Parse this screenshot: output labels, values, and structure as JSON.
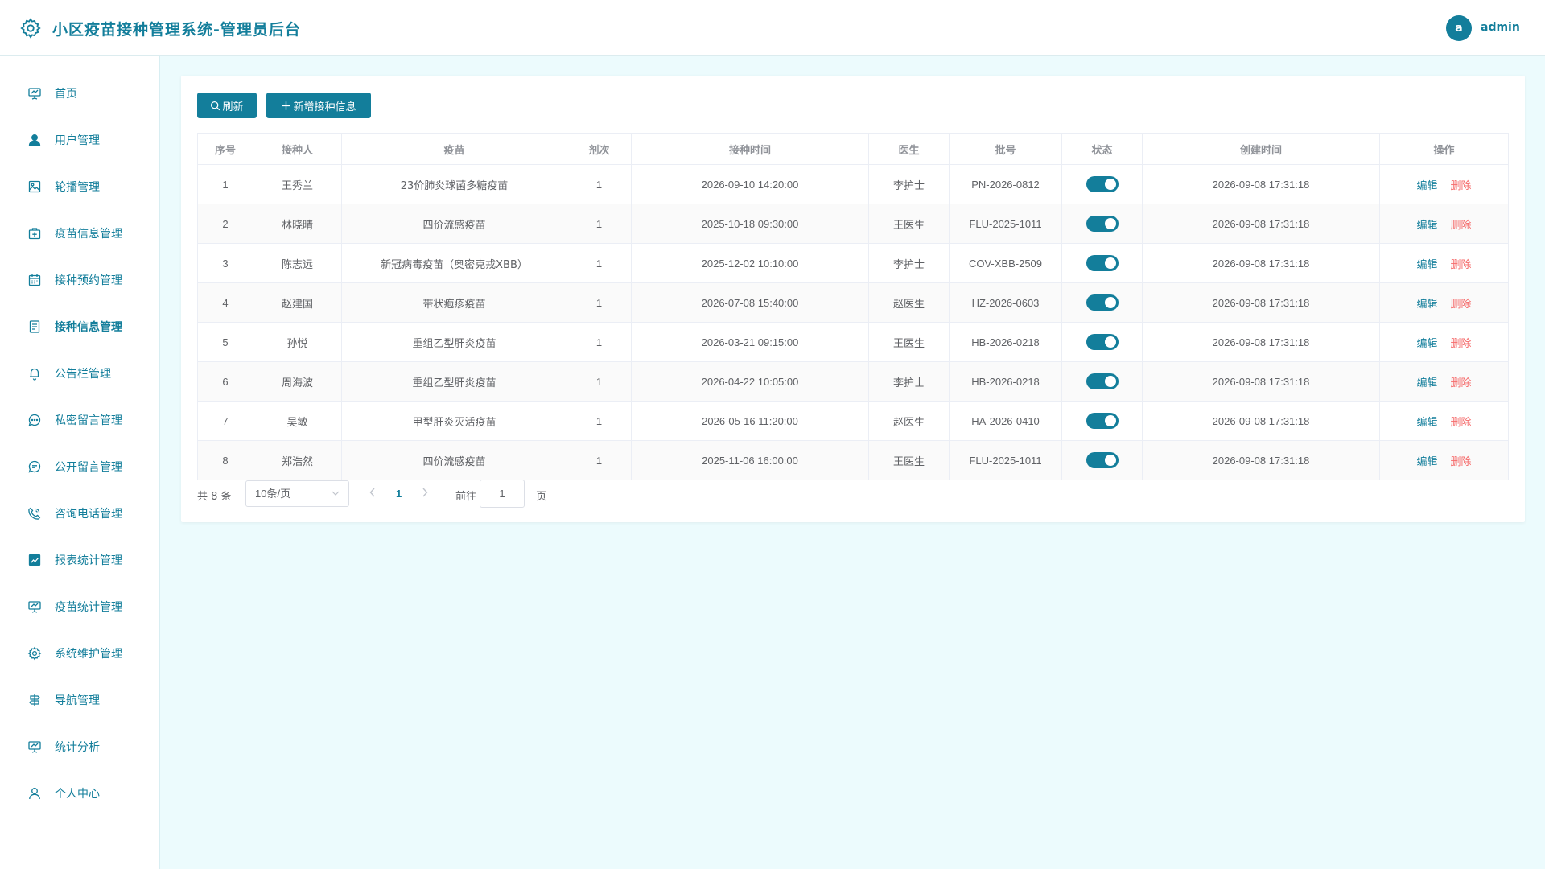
{
  "header": {
    "title": "小区疫苗接种管理系统-管理员后台",
    "avatar_letter": "a",
    "username": "admin"
  },
  "sidebar": {
    "items": [
      {
        "label": "首页",
        "icon": "presentation-icon"
      },
      {
        "label": "用户管理",
        "icon": "user-icon"
      },
      {
        "label": "轮播管理",
        "icon": "image-icon"
      },
      {
        "label": "疫苗信息管理",
        "icon": "medicine-box-icon"
      },
      {
        "label": "接种预约管理",
        "icon": "calendar-icon"
      },
      {
        "label": "接种信息管理",
        "icon": "document-icon",
        "active": true
      },
      {
        "label": "公告栏管理",
        "icon": "bell-icon"
      },
      {
        "label": "私密留言管理",
        "icon": "chat-dots-icon"
      },
      {
        "label": "公开留言管理",
        "icon": "chat-lines-icon"
      },
      {
        "label": "咨询电话管理",
        "icon": "phone-icon"
      },
      {
        "label": "报表统计管理",
        "icon": "chart-icon"
      },
      {
        "label": "疫苗统计管理",
        "icon": "presentation-icon"
      },
      {
        "label": "系统维护管理",
        "icon": "gear-icon"
      },
      {
        "label": "导航管理",
        "icon": "guide-icon"
      },
      {
        "label": "统计分析",
        "icon": "presentation-icon"
      },
      {
        "label": "个人中心",
        "icon": "user-outline-icon"
      }
    ]
  },
  "toolbar": {
    "refresh_label": "刷新",
    "add_label": "新增接种信息"
  },
  "table": {
    "columns": [
      "序号",
      "接种人",
      "疫苗",
      "剂次",
      "接种时间",
      "医生",
      "批号",
      "状态",
      "创建时间",
      "操作"
    ],
    "rows": [
      {
        "no": "1",
        "person": "王秀兰",
        "vaccine": "23价肺炎球菌多糖疫苗",
        "dose": "1",
        "time": "2026-09-10 14:20:00",
        "doctor": "李护士",
        "batch": "PN-2026-0812",
        "status": true,
        "created": "2026-09-08 17:31:18"
      },
      {
        "no": "2",
        "person": "林晓晴",
        "vaccine": "四价流感疫苗",
        "dose": "1",
        "time": "2025-10-18 09:30:00",
        "doctor": "王医生",
        "batch": "FLU-2025-1011",
        "status": true,
        "created": "2026-09-08 17:31:18"
      },
      {
        "no": "3",
        "person": "陈志远",
        "vaccine": "新冠病毒疫苗（奥密克戎XBB）",
        "dose": "1",
        "time": "2025-12-02 10:10:00",
        "doctor": "李护士",
        "batch": "COV-XBB-2509",
        "status": true,
        "created": "2026-09-08 17:31:18"
      },
      {
        "no": "4",
        "person": "赵建国",
        "vaccine": "带状疱疹疫苗",
        "dose": "1",
        "time": "2026-07-08 15:40:00",
        "doctor": "赵医生",
        "batch": "HZ-2026-0603",
        "status": true,
        "created": "2026-09-08 17:31:18"
      },
      {
        "no": "5",
        "person": "孙悦",
        "vaccine": "重组乙型肝炎疫苗",
        "dose": "1",
        "time": "2026-03-21 09:15:00",
        "doctor": "王医生",
        "batch": "HB-2026-0218",
        "status": true,
        "created": "2026-09-08 17:31:18"
      },
      {
        "no": "6",
        "person": "周海波",
        "vaccine": "重组乙型肝炎疫苗",
        "dose": "1",
        "time": "2026-04-22 10:05:00",
        "doctor": "李护士",
        "batch": "HB-2026-0218",
        "status": true,
        "created": "2026-09-08 17:31:18"
      },
      {
        "no": "7",
        "person": "吴敏",
        "vaccine": "甲型肝炎灭活疫苗",
        "dose": "1",
        "time": "2026-05-16 11:20:00",
        "doctor": "赵医生",
        "batch": "HA-2026-0410",
        "status": true,
        "created": "2026-09-08 17:31:18"
      },
      {
        "no": "8",
        "person": "郑浩然",
        "vaccine": "四价流感疫苗",
        "dose": "1",
        "time": "2025-11-06 16:00:00",
        "doctor": "王医生",
        "batch": "FLU-2025-1011",
        "status": true,
        "created": "2026-09-08 17:31:18"
      }
    ],
    "edit_label": "编辑",
    "delete_label": "删除"
  },
  "pagination": {
    "total_text": "共 8 条",
    "page_size": "10条/页",
    "current_page": "1",
    "goto_label": "前往",
    "goto_value": "1",
    "page_unit": "页"
  },
  "colors": {
    "primary": "#137e9b",
    "danger": "#f56c6c",
    "background": "#ecfbfd"
  }
}
